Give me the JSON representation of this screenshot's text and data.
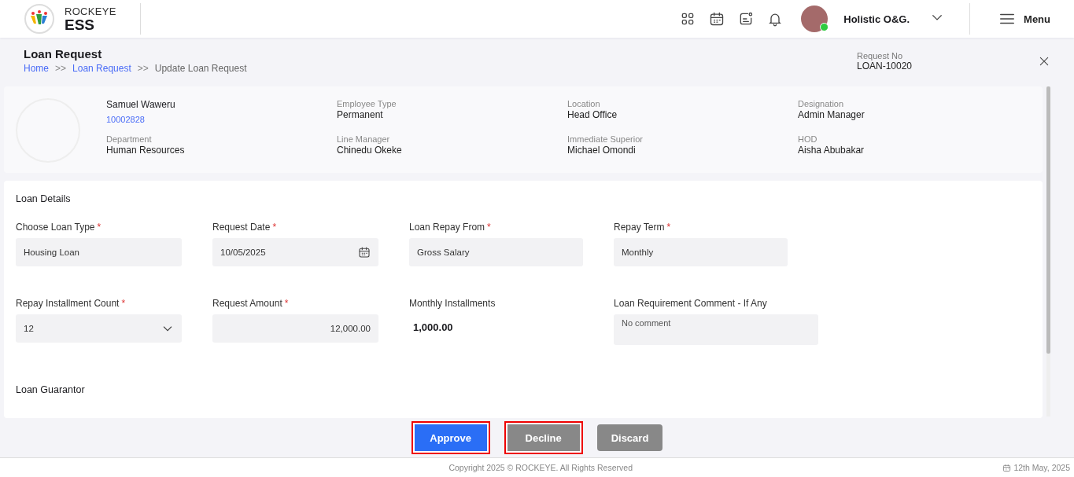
{
  "header": {
    "brand_top": "ROCKEYE",
    "brand_bottom": "ESS",
    "user_name": "Holistic O&G.",
    "user_online": true,
    "menu_label": "Menu"
  },
  "page": {
    "title": "Loan Request",
    "breadcrumbs": [
      {
        "label": "Home",
        "link": true
      },
      {
        "label": "Loan Request",
        "link": true
      },
      {
        "label": "Update Loan Request",
        "link": false
      }
    ],
    "separator": ">>",
    "request_no_label": "Request No",
    "request_no": "LOAN-10020"
  },
  "employee": {
    "name": "Samuel Waweru",
    "id": "10002828",
    "details": [
      {
        "label": "Department",
        "value": "Human Resources"
      },
      {
        "label": "Employee Type",
        "value": "Permanent"
      },
      {
        "label": "Line Manager",
        "value": "Chinedu Okeke"
      },
      {
        "label": "Location",
        "value": "Head Office"
      },
      {
        "label": "Immediate Superior",
        "value": "Michael Omondi"
      },
      {
        "label": "Designation",
        "value": "Admin Manager"
      },
      {
        "label": "HOD",
        "value": "Aisha Abubakar"
      }
    ]
  },
  "loan_details": {
    "title": "Loan Details",
    "fields": [
      {
        "kind": "text",
        "label": "Choose Loan Type",
        "mark": "*",
        "value": "Housing Loan"
      },
      {
        "kind": "date",
        "label": "Request Date",
        "mark": "*",
        "value": "10/05/2025"
      },
      {
        "kind": "text",
        "label": "Loan Repay From",
        "mark": "*",
        "value": "Gross Salary"
      },
      {
        "kind": "text",
        "label": "Repay Term",
        "mark": "*",
        "value": "Monthly"
      },
      {
        "kind": "select",
        "label": "Repay Installment Count",
        "mark": "*",
        "value": "12"
      },
      {
        "kind": "amount",
        "label": "Request Amount",
        "mark": "*",
        "value": "12,000.00"
      },
      {
        "kind": "static",
        "label": "Monthly Installments",
        "value": "1,000.00"
      },
      {
        "kind": "textarea",
        "label": "Loan Requirement Comment - If Any",
        "value": "No comment"
      }
    ]
  },
  "loan_guarantor": {
    "title": "Loan Guarantor"
  },
  "actions": [
    {
      "label": "Approve",
      "kind": "primary",
      "highlighted": true
    },
    {
      "label": "Decline",
      "kind": "secondary",
      "highlighted": true
    },
    {
      "label": "Discard",
      "kind": "secondary",
      "highlighted": false
    }
  ],
  "footer": {
    "copyright": "Copyright 2025 © ROCKEYE. All Rights Reserved",
    "date": "12th May, 2025"
  }
}
